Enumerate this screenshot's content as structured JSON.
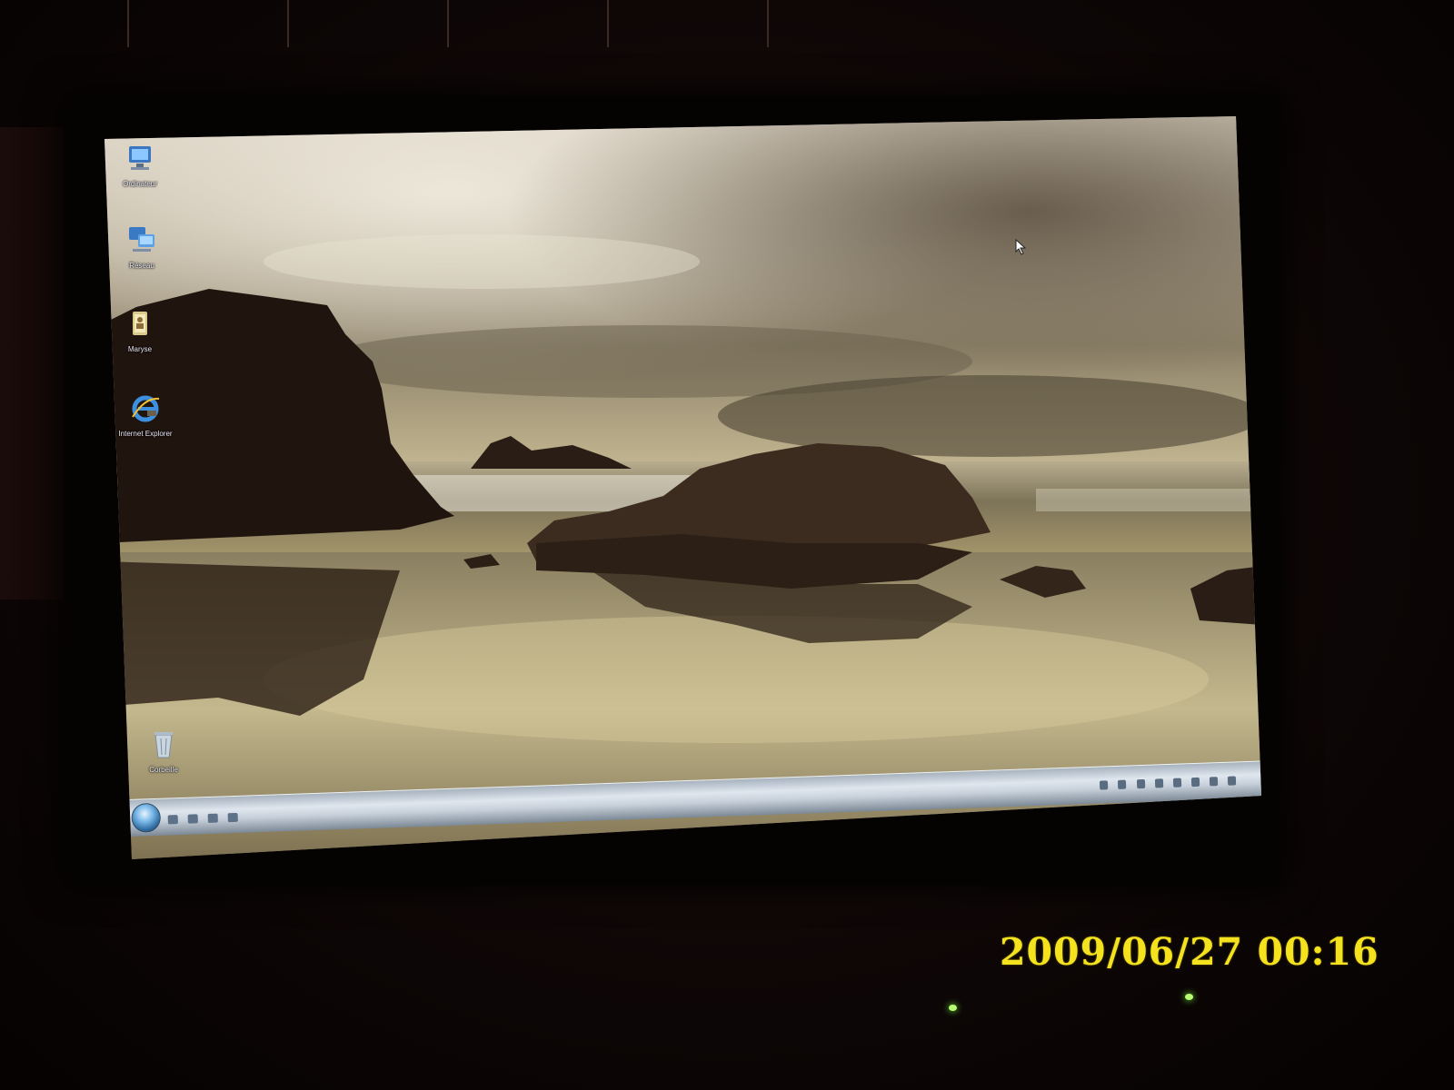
{
  "desktop": {
    "icons": [
      {
        "id": "computer",
        "label": "Ordinateur",
        "icon": "computer-icon"
      },
      {
        "id": "network",
        "label": "Réseau",
        "icon": "network-icon"
      },
      {
        "id": "user",
        "label": "Maryse",
        "icon": "user-folder-icon"
      },
      {
        "id": "ie",
        "label": "Internet Explorer",
        "icon": "internet-explorer-icon"
      },
      {
        "id": "recycle",
        "label": "Corbeille",
        "icon": "recycle-bin-icon"
      }
    ]
  },
  "taskbar": {
    "start_icon": "windows-start-orb-icon",
    "quick_launch_icons": [
      "show-desktop-icon",
      "switch-windows-icon",
      "ie-quicklaunch-icon",
      "media-icon"
    ]
  },
  "camera": {
    "timestamp": "2009/06/27 00:16"
  },
  "colors": {
    "timestamp": "#f3e21d",
    "led": "#b9ff74",
    "taskbar": "#c7d0da"
  }
}
